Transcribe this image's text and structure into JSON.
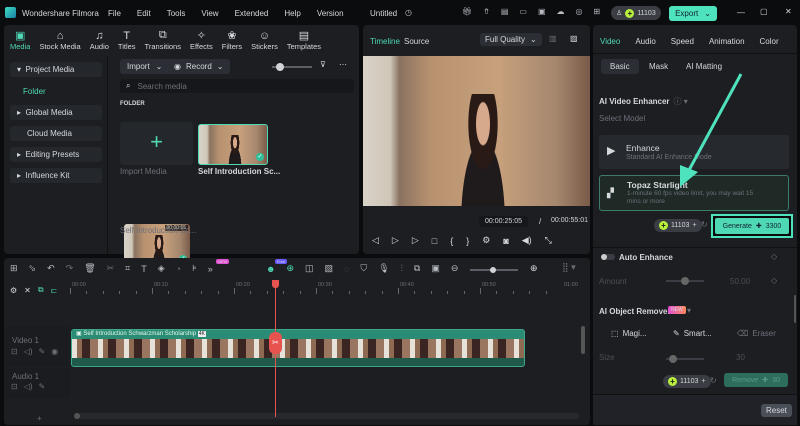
{
  "app": {
    "title": "Wondershare Filmora",
    "project": "Untitled",
    "menu": [
      "File",
      "Edit",
      "Tools",
      "View",
      "Extended",
      "Help",
      "Version"
    ],
    "credits": "11103",
    "export": "Export"
  },
  "tabs": [
    {
      "label": "Media",
      "icon": "media-icon"
    },
    {
      "label": "Stock Media",
      "icon": "stock-icon"
    },
    {
      "label": "Audio",
      "icon": "music-icon"
    },
    {
      "label": "Titles",
      "icon": "text-icon"
    },
    {
      "label": "Transitions",
      "icon": "transition-icon"
    },
    {
      "label": "Effects",
      "icon": "effects-icon"
    },
    {
      "label": "Filters",
      "icon": "filter-icon"
    },
    {
      "label": "Stickers",
      "icon": "sticker-icon"
    },
    {
      "label": "Templates",
      "icon": "template-icon"
    }
  ],
  "sidebar": {
    "items": [
      {
        "label": "Project Media"
      },
      {
        "label": "Folder"
      },
      {
        "label": "Global Media"
      },
      {
        "label": "Cloud Media"
      },
      {
        "label": "Editing Presets"
      },
      {
        "label": "Influence Kit"
      }
    ]
  },
  "media": {
    "import": "Import",
    "record": "Record",
    "search_placeholder": "Search media",
    "folder_label": "FOLDER",
    "import_media": "Import Media",
    "clips": [
      {
        "name": "Self Introduction Sc..."
      },
      {
        "name": "Self Introduction Sc...",
        "duration": "00:00:55"
      }
    ]
  },
  "preview": {
    "tab_timeline": "Timeline",
    "tab_source": "Source",
    "quality": "Full Quality",
    "current": "00:00:25:05",
    "separator": "/",
    "total": "00:00:55:01",
    "progress": 0.46
  },
  "inspector": {
    "tabs": [
      "Video",
      "Audio",
      "Speed",
      "Animation",
      "Color"
    ],
    "subtabs": [
      "Basic",
      "Mask",
      "AI Matting"
    ],
    "section": "AI Video Enhancer",
    "select_model": "Select Model",
    "models": [
      {
        "name": "Enhance",
        "desc": "Standard AI Enhance Mode"
      },
      {
        "name": "Topaz Starlight",
        "desc": "1-minute 60 fps video limit, you may wait 15 mins or more"
      }
    ],
    "credits": "11103",
    "generate": "Generate",
    "generate_cost": "3300",
    "auto_enhance": "Auto Enhance",
    "amount_label": "Amount",
    "amount_value": "50.00",
    "amount_fraction": 0.5,
    "object_remover": "AI Object Remover",
    "new_badge": "NEW",
    "tools": [
      "Magi...",
      "Smart...",
      "Eraser"
    ],
    "size_label": "Size",
    "size_value": "30",
    "size_fraction": 0.2,
    "remove": "Remove",
    "remove_cost": "30",
    "reset": "Reset"
  },
  "timeline": {
    "ruler": [
      "00:00",
      "00:10",
      "00:20",
      "00:30",
      "00:40",
      "00:50",
      "01:00"
    ],
    "tracks": [
      {
        "label": "Video 1"
      },
      {
        "label": "Audio 1"
      }
    ],
    "clip_title": "Self Introduction Schwarzman Scholarship",
    "clip_badge": "4K",
    "playhead_seconds": 25,
    "badge_new": "NEW",
    "badge_free": "Free"
  },
  "colors": {
    "accent": "#4fd8b4",
    "playhead": "#e8534f"
  }
}
